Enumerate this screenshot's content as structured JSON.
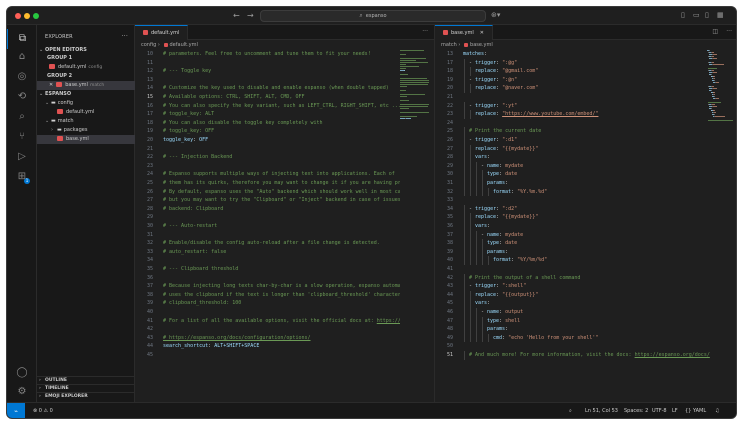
{
  "titlebar": {
    "search_text": "espanso",
    "back_icon": "←",
    "forward_icon": "→",
    "search_icon": "⌕",
    "copilot_icon": "⊛▾"
  },
  "activity": {
    "icons": [
      "files-icon",
      "search-icon",
      "source-control-icon",
      "run-debug-icon",
      "extensions-icon",
      "remote-icon",
      "testing-icon",
      "accounts-icon",
      "settings-icon"
    ],
    "badge": "1"
  },
  "sidebar": {
    "title": "EXPLORER",
    "more": "···",
    "open_editors": "OPEN EDITORS",
    "group1": "GROUP 1",
    "group1_file": "default.yml",
    "group1_desc": "config",
    "group2": "GROUP 2",
    "group2_file": "base.yml",
    "group2_desc": "match",
    "root": "ESPANSO",
    "folder_config": "config",
    "file_default": "default.yml",
    "folder_match": "match",
    "folder_packages": "packages",
    "file_base": "base.yml",
    "outline": "OUTLINE",
    "timeline": "TIMELINE",
    "emoji": "EMOJI EXPLORER"
  },
  "left_editor": {
    "tab": "default.yml",
    "breadcrumb": [
      "config",
      "default.yml"
    ],
    "lines": [
      {
        "n": "10",
        "t": [
          [
            "cm",
            "# parameters. Feel free to uncomment and tune them to fit your needs!"
          ]
        ]
      },
      {
        "n": "11",
        "t": []
      },
      {
        "n": "12",
        "t": [
          [
            "cm",
            "# --- Toggle key"
          ]
        ]
      },
      {
        "n": "13",
        "t": []
      },
      {
        "n": "14",
        "t": [
          [
            "cm",
            "# Customize the key used to disable and enable espanso (when double tapped)"
          ]
        ]
      },
      {
        "n": "15",
        "t": [
          [
            "cm",
            "# Available options: CTRL, SHIFT, ALT, CMD, OFF"
          ]
        ]
      },
      {
        "n": "16",
        "t": [
          [
            "cm",
            "# You can also specify the key variant, such as LEFT_CTRL, RIGHT_SHIFT, etc ..."
          ]
        ]
      },
      {
        "n": "17",
        "t": [
          [
            "cm",
            "# toggle_key: ALT"
          ]
        ]
      },
      {
        "n": "18",
        "t": [
          [
            "cm",
            "# You can also disable the toggle key completely with"
          ]
        ]
      },
      {
        "n": "19",
        "t": [
          [
            "cm",
            "# toggle_key: OFF"
          ]
        ]
      },
      {
        "n": "20",
        "t": [
          [
            "ky",
            "toggle_key"
          ],
          [
            "pl",
            ": "
          ],
          [
            "ky",
            "OFF"
          ]
        ]
      },
      {
        "n": "21",
        "t": []
      },
      {
        "n": "22",
        "t": [
          [
            "cm",
            "# --- Injection Backend"
          ]
        ]
      },
      {
        "n": "23",
        "t": []
      },
      {
        "n": "24",
        "t": [
          [
            "cm",
            "# Espanso supports multiple ways of injecting text into applications. Each of"
          ]
        ]
      },
      {
        "n": "25",
        "t": [
          [
            "cm",
            "# them has its quirks, therefore you may want to change it if you are having proble"
          ]
        ]
      },
      {
        "n": "26",
        "t": [
          [
            "cm",
            "# By default, espanso uses the \"Auto\" backend which should work well in most cases,"
          ]
        ]
      },
      {
        "n": "27",
        "t": [
          [
            "cm",
            "# but you may want to try the \"Clipboard\" or \"Inject\" backend in case of issues."
          ]
        ]
      },
      {
        "n": "28",
        "t": [
          [
            "cm",
            "# backend: Clipboard"
          ]
        ]
      },
      {
        "n": "29",
        "t": []
      },
      {
        "n": "30",
        "t": [
          [
            "cm",
            "# --- Auto-restart"
          ]
        ]
      },
      {
        "n": "31",
        "t": []
      },
      {
        "n": "32",
        "t": [
          [
            "cm",
            "# Enable/disable the config auto-reload after a file change is detected."
          ]
        ]
      },
      {
        "n": "33",
        "t": [
          [
            "cm",
            "# auto_restart: false"
          ]
        ]
      },
      {
        "n": "34",
        "t": []
      },
      {
        "n": "35",
        "t": [
          [
            "cm",
            "# --- Clipboard threshold"
          ]
        ]
      },
      {
        "n": "36",
        "t": []
      },
      {
        "n": "37",
        "t": [
          [
            "cm",
            "# Because injecting long texts char-by-char is a slow operation, espanso automatic"
          ]
        ]
      },
      {
        "n": "38",
        "t": [
          [
            "cm",
            "# uses the clipboard if the text is longer than 'clipboard_threshold' characters."
          ]
        ]
      },
      {
        "n": "39",
        "t": [
          [
            "cm",
            "# clipboard_threshold: 100"
          ]
        ]
      },
      {
        "n": "40",
        "t": []
      },
      {
        "n": "41",
        "t": [
          [
            "cm",
            "# For a list of all the available options, visit the official docs at: "
          ],
          [
            "cmu",
            "https://espa"
          ]
        ]
      },
      {
        "n": "42",
        "t": []
      },
      {
        "n": "43",
        "t": [
          [
            "cmu",
            "# https://espanso.org/docs/configuration/options/"
          ]
        ]
      },
      {
        "n": "44",
        "t": [
          [
            "ky",
            "search_shortcut"
          ],
          [
            "pl",
            ": "
          ],
          [
            "ky",
            "ALT+SHIFT+SPACE"
          ]
        ]
      },
      {
        "n": "45",
        "t": []
      }
    ]
  },
  "right_editor": {
    "tab": "base.yml",
    "breadcrumb": [
      "match",
      "base.yml"
    ],
    "lines": [
      {
        "n": "13",
        "i": 0,
        "t": [
          [
            "ky",
            "matches"
          ],
          [
            "pl",
            ":"
          ]
        ]
      },
      {
        "n": "17",
        "i": 1,
        "t": [
          [
            "pl",
            "- "
          ],
          [
            "ky",
            "trigger"
          ],
          [
            "pl",
            ": "
          ],
          [
            "st",
            "\":@g\""
          ]
        ]
      },
      {
        "n": "18",
        "i": 2,
        "t": [
          [
            "ky",
            "replace"
          ],
          [
            "pl",
            ": "
          ],
          [
            "st",
            "\"@gmail.com\""
          ]
        ]
      },
      {
        "n": "19",
        "i": 1,
        "t": [
          [
            "pl",
            "- "
          ],
          [
            "ky",
            "trigger"
          ],
          [
            "pl",
            ": "
          ],
          [
            "st",
            "\":@n\""
          ]
        ]
      },
      {
        "n": "20",
        "i": 2,
        "t": [
          [
            "ky",
            "replace"
          ],
          [
            "pl",
            ": "
          ],
          [
            "st",
            "\"@naver.com\""
          ]
        ]
      },
      {
        "n": "21",
        "i": 0,
        "t": []
      },
      {
        "n": "22",
        "i": 1,
        "t": [
          [
            "pl",
            "- "
          ],
          [
            "ky",
            "trigger"
          ],
          [
            "pl",
            ": "
          ],
          [
            "st",
            "\":yt\""
          ]
        ]
      },
      {
        "n": "23",
        "i": 2,
        "t": [
          [
            "ky",
            "replace"
          ],
          [
            "pl",
            ": "
          ],
          [
            "stu",
            "\"https://www.youtube.com/embed/\""
          ]
        ]
      },
      {
        "n": "24",
        "i": 0,
        "t": []
      },
      {
        "n": "25",
        "i": 1,
        "t": [
          [
            "cm",
            "# Print the current date"
          ]
        ]
      },
      {
        "n": "26",
        "i": 1,
        "t": [
          [
            "pl",
            "- "
          ],
          [
            "ky",
            "trigger"
          ],
          [
            "pl",
            ": "
          ],
          [
            "st",
            "\":d1\""
          ]
        ]
      },
      {
        "n": "27",
        "i": 2,
        "t": [
          [
            "ky",
            "replace"
          ],
          [
            "pl",
            ": "
          ],
          [
            "st",
            "\"{{mydate}}\""
          ]
        ]
      },
      {
        "n": "28",
        "i": 2,
        "t": [
          [
            "ky",
            "vars"
          ],
          [
            "pl",
            ":"
          ]
        ]
      },
      {
        "n": "29",
        "i": 3,
        "t": [
          [
            "pl",
            "- "
          ],
          [
            "ky",
            "name"
          ],
          [
            "pl",
            ": "
          ],
          [
            "st",
            "mydate"
          ]
        ]
      },
      {
        "n": "30",
        "i": 4,
        "t": [
          [
            "ky",
            "type"
          ],
          [
            "pl",
            ": "
          ],
          [
            "st",
            "date"
          ]
        ]
      },
      {
        "n": "31",
        "i": 4,
        "t": [
          [
            "ky",
            "params"
          ],
          [
            "pl",
            ":"
          ]
        ]
      },
      {
        "n": "32",
        "i": 5,
        "t": [
          [
            "ky",
            "format"
          ],
          [
            "pl",
            ": "
          ],
          [
            "st",
            "\"%Y.%m.%d\""
          ]
        ]
      },
      {
        "n": "33",
        "i": 0,
        "t": []
      },
      {
        "n": "34",
        "i": 1,
        "t": [
          [
            "pl",
            "- "
          ],
          [
            "ky",
            "trigger"
          ],
          [
            "pl",
            ": "
          ],
          [
            "st",
            "\":d2\""
          ]
        ]
      },
      {
        "n": "35",
        "i": 2,
        "t": [
          [
            "ky",
            "replace"
          ],
          [
            "pl",
            ": "
          ],
          [
            "st",
            "\"{{mydate}}\""
          ]
        ]
      },
      {
        "n": "36",
        "i": 2,
        "t": [
          [
            "ky",
            "vars"
          ],
          [
            "pl",
            ":"
          ]
        ]
      },
      {
        "n": "37",
        "i": 3,
        "t": [
          [
            "pl",
            "- "
          ],
          [
            "ky",
            "name"
          ],
          [
            "pl",
            ": "
          ],
          [
            "st",
            "mydate"
          ]
        ]
      },
      {
        "n": "38",
        "i": 4,
        "t": [
          [
            "ky",
            "type"
          ],
          [
            "pl",
            ": "
          ],
          [
            "st",
            "date"
          ]
        ]
      },
      {
        "n": "39",
        "i": 4,
        "t": [
          [
            "ky",
            "params"
          ],
          [
            "pl",
            ":"
          ]
        ]
      },
      {
        "n": "40",
        "i": 5,
        "t": [
          [
            "ky",
            "format"
          ],
          [
            "pl",
            ": "
          ],
          [
            "st",
            "\"%Y/%m/%d\""
          ]
        ]
      },
      {
        "n": "41",
        "i": 0,
        "t": []
      },
      {
        "n": "42",
        "i": 1,
        "t": [
          [
            "cm",
            "# Print the output of a shell command"
          ]
        ]
      },
      {
        "n": "43",
        "i": 1,
        "t": [
          [
            "pl",
            "- "
          ],
          [
            "ky",
            "trigger"
          ],
          [
            "pl",
            ": "
          ],
          [
            "st",
            "\":shell\""
          ]
        ]
      },
      {
        "n": "44",
        "i": 2,
        "t": [
          [
            "ky",
            "replace"
          ],
          [
            "pl",
            ": "
          ],
          [
            "st",
            "\"{{output}}\""
          ]
        ]
      },
      {
        "n": "45",
        "i": 2,
        "t": [
          [
            "ky",
            "vars"
          ],
          [
            "pl",
            ":"
          ]
        ]
      },
      {
        "n": "46",
        "i": 3,
        "t": [
          [
            "pl",
            "- "
          ],
          [
            "ky",
            "name"
          ],
          [
            "pl",
            ": "
          ],
          [
            "st",
            "output"
          ]
        ]
      },
      {
        "n": "47",
        "i": 4,
        "t": [
          [
            "ky",
            "type"
          ],
          [
            "pl",
            ": "
          ],
          [
            "st",
            "shell"
          ]
        ]
      },
      {
        "n": "48",
        "i": 4,
        "t": [
          [
            "ky",
            "params"
          ],
          [
            "pl",
            ":"
          ]
        ]
      },
      {
        "n": "49",
        "i": 5,
        "t": [
          [
            "ky",
            "cmd"
          ],
          [
            "pl",
            ": "
          ],
          [
            "st",
            "\"echo 'Hello from your shell'\""
          ]
        ]
      },
      {
        "n": "50",
        "i": 0,
        "t": []
      },
      {
        "n": "51",
        "i": 1,
        "cur": true,
        "t": [
          [
            "cm",
            "# And much more! For more information, visit the docs: "
          ],
          [
            "cmu",
            "https://espanso.org/docs/"
          ]
        ]
      }
    ]
  },
  "statusbar": {
    "remote": "⌁",
    "problems": "⊗ 0  ⚠ 0",
    "zoom_icon": "🔍",
    "position": "Ln 51, Col 53",
    "spaces": "Spaces: 2",
    "encoding": "UTF-8",
    "eol": "LF",
    "language": "{} YAML",
    "bell": "🔔"
  },
  "colors": {
    "accent": "#0078d4",
    "yaml_icon": "#e05252",
    "comment": "#6a9955",
    "key": "#9cdcfe",
    "string": "#ce9178"
  }
}
